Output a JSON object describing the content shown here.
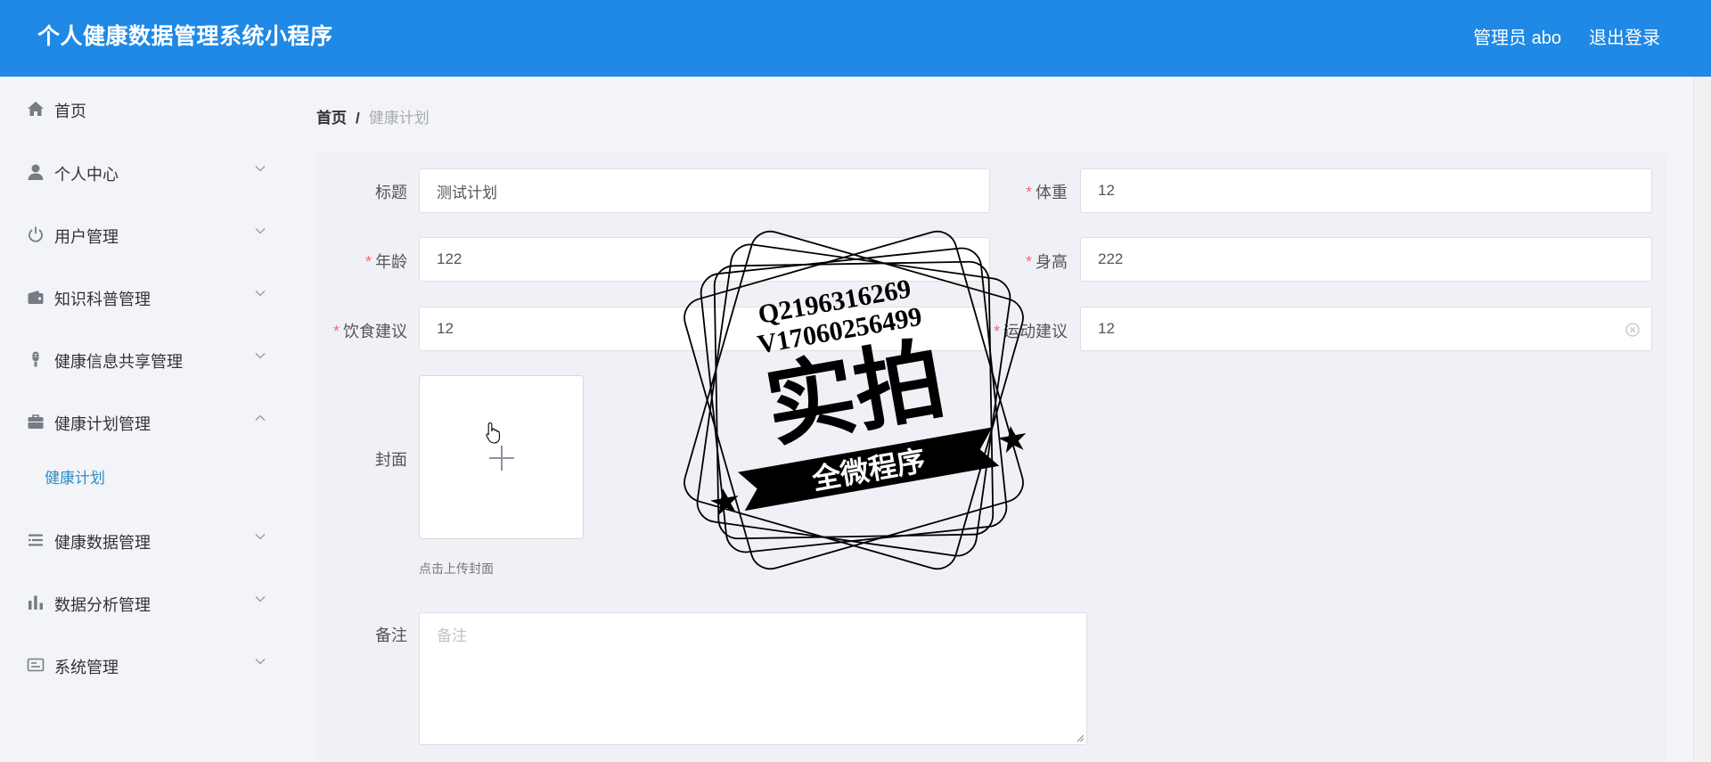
{
  "header": {
    "title": "个人健康数据管理系统小程序",
    "user": "管理员 abo",
    "logout": "退出登录"
  },
  "sidebar": {
    "items": [
      {
        "label": "首页",
        "icon": "home-icon"
      },
      {
        "label": "个人中心",
        "icon": "user-icon"
      },
      {
        "label": "用户管理",
        "icon": "power-icon"
      },
      {
        "label": "知识科普管理",
        "icon": "wallet-icon"
      },
      {
        "label": "健康信息共享管理",
        "icon": "microphone-icon"
      },
      {
        "label": "健康计划管理",
        "icon": "briefcase-icon"
      },
      {
        "label": "健康数据管理",
        "icon": "list-icon"
      },
      {
        "label": "数据分析管理",
        "icon": "bar-chart-icon"
      },
      {
        "label": "系统管理",
        "icon": "id-card-icon"
      }
    ],
    "sub_items": [
      {
        "label": "健康计划"
      }
    ],
    "active_color": "#2d8cc7"
  },
  "breadcrumb": {
    "home": "首页",
    "separator": "/",
    "current": "健康计划"
  },
  "form": {
    "title_label": "标题",
    "title_value": "测试计划",
    "weight_label": "体重",
    "weight_value": "12",
    "age_label": "年龄",
    "age_value": "122",
    "height_label": "身高",
    "height_value": "222",
    "diet_label": "饮食建议",
    "diet_value": "12",
    "exercise_label": "运动建议",
    "exercise_value": "12",
    "cover_label": "封面",
    "upload_tip": "点击上传封面",
    "remark_label": "备注",
    "remark_placeholder": "备注",
    "required_mark": "*"
  },
  "watermark": {
    "line1": "Q2196316269",
    "line2": "V17060256499",
    "main": "实拍",
    "banner": "全微程序"
  },
  "colors": {
    "header": "#1f89e5",
    "required": "#f56c6c",
    "background": "#f3f4f8"
  }
}
